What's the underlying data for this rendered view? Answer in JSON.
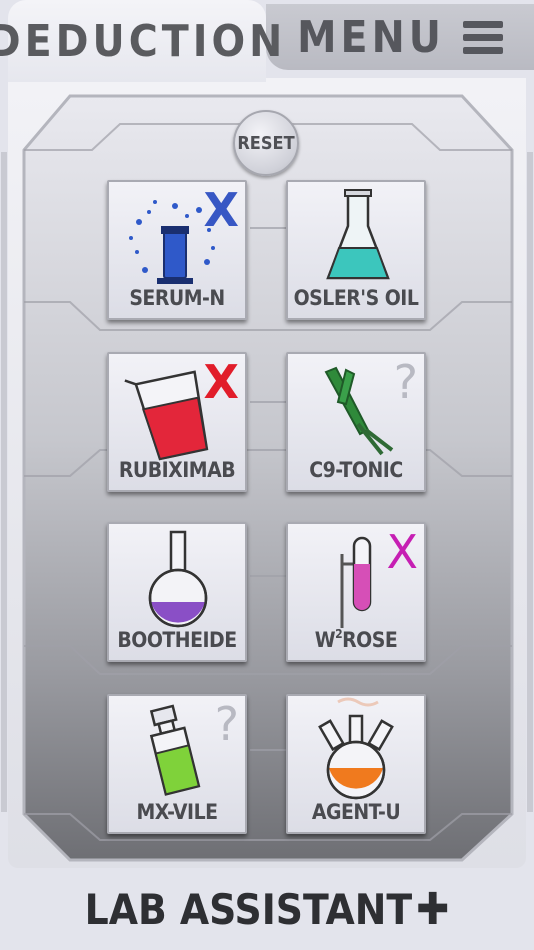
{
  "tabs": {
    "deduction": "DEDUCTION",
    "menu": "MENU"
  },
  "reset_label": "RESET",
  "cards": [
    {
      "name": "Serum-N",
      "label": "SERUM-N",
      "mark": "X",
      "mark_color": "#3757c4",
      "icon": "serum-vial-icon",
      "liquid": "#2f59c9"
    },
    {
      "name": "Osler's Oil",
      "label": "OSLER'S OIL",
      "mark": "",
      "mark_color": "",
      "icon": "erlenmeyer-flask-icon",
      "liquid": "#3cc6bd"
    },
    {
      "name": "Rubiximab",
      "label": "RUBIXIMAB",
      "mark": "X",
      "mark_color": "#e11d2a",
      "icon": "beaker-icon",
      "liquid": "#e3263a"
    },
    {
      "name": "C9-Tonic",
      "label": "C9-TONIC",
      "mark": "?",
      "mark_color": "#b8b9c2",
      "icon": "test-tubes-icon",
      "liquid": "#2f8a3a"
    },
    {
      "name": "Bootheide",
      "label": "BOOTHEIDE",
      "mark": "",
      "mark_color": "",
      "icon": "round-flask-icon",
      "liquid": "#8a4fc6"
    },
    {
      "name": "W2Rose",
      "label_main": "W",
      "label_sup": "2",
      "label_rest": "ROSE",
      "mark": "X",
      "mark_color": "#c61fb3",
      "icon": "test-tube-stand-icon",
      "liquid": "#d64fb7"
    },
    {
      "name": "Mx-Vile",
      "label": "MX-VILE",
      "mark": "?",
      "mark_color": "#b8b9c2",
      "icon": "bottle-icon",
      "liquid": "#7fd23a"
    },
    {
      "name": "Agent-U",
      "label": "AGENT-U",
      "mark": "",
      "mark_color": "",
      "icon": "three-neck-flask-icon",
      "liquid": "#f07a1e"
    }
  ],
  "footer": {
    "title": "LAB ASSISTANT",
    "plus": "✚"
  }
}
